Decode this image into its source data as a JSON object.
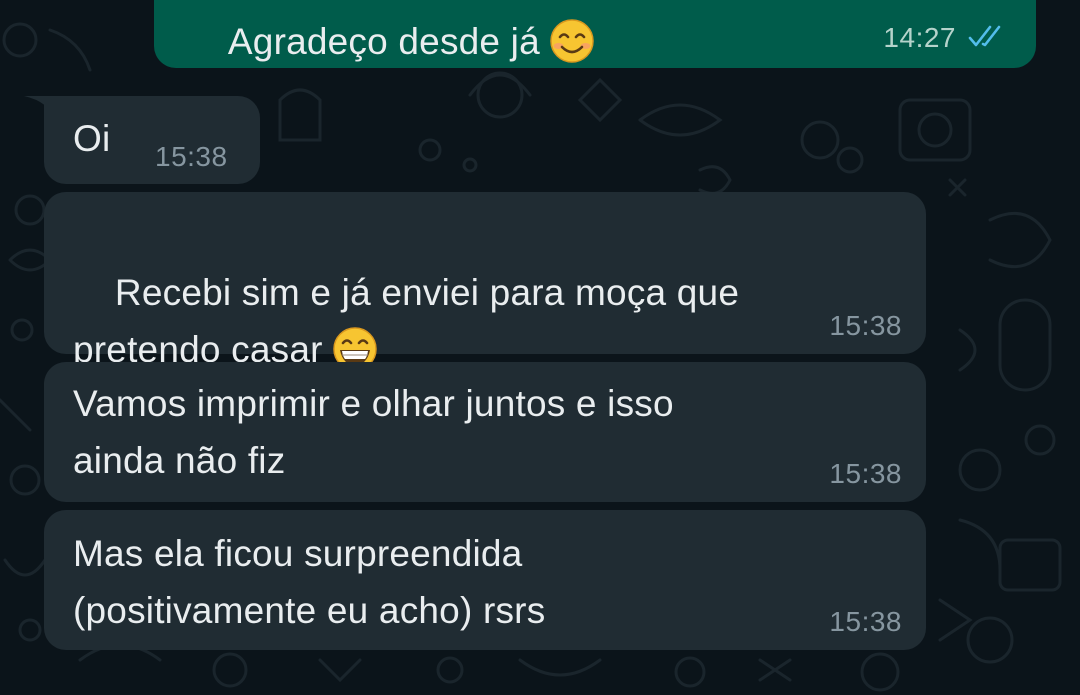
{
  "chat": {
    "messages": [
      {
        "direction": "outgoing",
        "text": "Agradeço desde já",
        "emoji": "smiling-face-with-smiling-eyes",
        "time": "14:27",
        "status": "read-double-check"
      },
      {
        "direction": "incoming",
        "text": "Oi",
        "time": "15:38"
      },
      {
        "direction": "incoming",
        "text": "Recebi sim e já enviei para moça que\npretendo casar",
        "emoji": "grinning-face-with-smiling-eyes",
        "time": "15:38"
      },
      {
        "direction": "incoming",
        "text": "Vamos imprimir e olhar juntos e isso\nainda não fiz",
        "time": "15:38"
      },
      {
        "direction": "incoming",
        "text": "Mas ela ficou surpreendida\n(positivamente eu acho) rsrs",
        "time": "15:38"
      }
    ]
  },
  "colors": {
    "background": "#0b141a",
    "outgoing_bubble": "#005c4b",
    "incoming_bubble": "#202c33",
    "text": "#e9edef",
    "timestamp": "#8696a0",
    "read_ticks": "#53bdeb"
  }
}
